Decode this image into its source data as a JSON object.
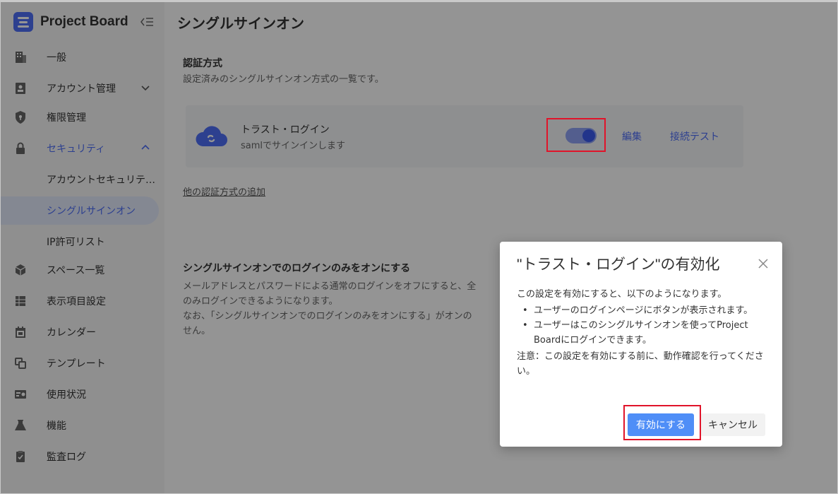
{
  "app": {
    "title": "Project Board"
  },
  "sidebar": {
    "items": [
      {
        "label": "一般",
        "icon": "building-icon"
      },
      {
        "label": "アカウント管理",
        "icon": "id-card-icon"
      },
      {
        "label": "権限管理",
        "icon": "shield-icon"
      },
      {
        "label": "セキュリティ",
        "icon": "lock-icon"
      },
      {
        "label": "アカウントセキュリテ…"
      },
      {
        "label": "シングルサインオン"
      },
      {
        "label": "IP許可リスト"
      },
      {
        "label": "スペース一覧",
        "icon": "cube-icon"
      },
      {
        "label": "表示項目設定",
        "icon": "table-icon"
      },
      {
        "label": "カレンダー",
        "icon": "calendar-icon"
      },
      {
        "label": "テンプレート",
        "icon": "copy-icon"
      },
      {
        "label": "使用状況",
        "icon": "usage-icon"
      },
      {
        "label": "機能",
        "icon": "flask-icon"
      },
      {
        "label": "監査ログ",
        "icon": "clipboard-icon"
      }
    ]
  },
  "main": {
    "page_title": "シングルサインオン",
    "auth": {
      "title": "認証方式",
      "description": "設定済みのシングルサインオン方式の一覧です。",
      "card": {
        "name": "トラスト・ログイン",
        "subtitle": "samlでサインインします",
        "toggle_on": true,
        "edit_label": "編集",
        "test_label": "接続テスト"
      },
      "add_link": "他の認証方式の追加"
    },
    "sso_only": {
      "title": "シングルサインオンでのログインのみをオンにする",
      "desc_line1": "メールアドレスとパスワードによる通常のログインをオフにすると、全",
      "desc_line2": "のみログインできるようになります。",
      "desc_line3": "なお、「シングルサインオンでのログインのみをオンにする」がオンの",
      "desc_line4": "せん。"
    }
  },
  "modal": {
    "title": "\"トラスト・ログイン\"の有効化",
    "intro": "この設定を有効にすると、以下のようになります。",
    "bullets": [
      "ユーザーのログインページにボタンが表示されます。",
      "ユーザーはこのシングルサインオンを使ってProject Boardにログインできます。"
    ],
    "note": "注意：この設定を有効にする前に、動作確認を行ってください。",
    "confirm_label": "有効にする",
    "cancel_label": "キャンセル"
  },
  "colors": {
    "accent": "#4f6ef7",
    "highlight": "#e0142a"
  }
}
